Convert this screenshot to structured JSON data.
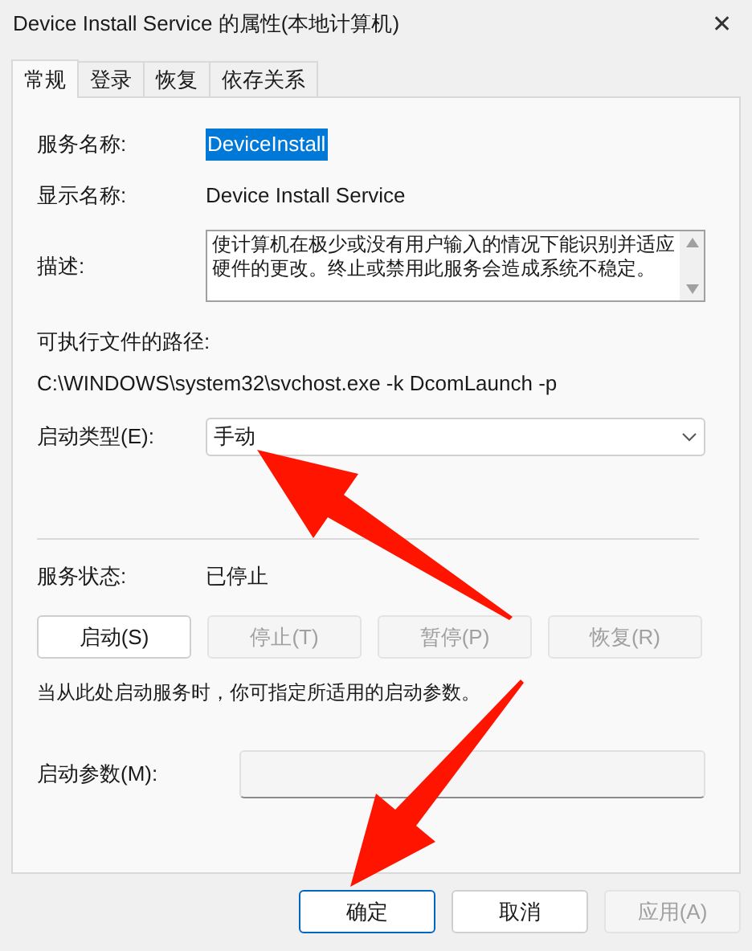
{
  "window": {
    "title": "Device Install Service 的属性(本地计算机)",
    "close": "✕"
  },
  "tabs": [
    {
      "label": "常规",
      "selected": true
    },
    {
      "label": "登录",
      "selected": false
    },
    {
      "label": "恢复",
      "selected": false
    },
    {
      "label": "依存关系",
      "selected": false
    }
  ],
  "service_name": {
    "label": "服务名称:",
    "value": "DeviceInstall",
    "selected": true
  },
  "display_name": {
    "label": "显示名称:",
    "value": "Device Install Service"
  },
  "description": {
    "label": "描述:",
    "value": "使计算机在极少或没有用户输入的情况下能识别并适应硬件的更改。终止或禁用此服务会造成系统不稳定。"
  },
  "executable_path": {
    "label": "可执行文件的路径:",
    "value": "C:\\WINDOWS\\system32\\svchost.exe -k DcomLaunch -p"
  },
  "startup_type": {
    "label": "启动类型(E):",
    "value": "手动"
  },
  "service_status": {
    "label": "服务状态:",
    "value": "已停止"
  },
  "service_buttons": [
    {
      "label": "启动(S)",
      "disabled": false
    },
    {
      "label": "停止(T)",
      "disabled": true
    },
    {
      "label": "暂停(P)",
      "disabled": true
    },
    {
      "label": "恢复(R)",
      "disabled": true
    }
  ],
  "hint": "当从此处启动服务时，你可指定所适用的启动参数。",
  "start_parameters": {
    "label": "启动参数(M):",
    "disabled": true
  },
  "dialog_buttons": [
    {
      "label": "确定",
      "default": true,
      "disabled": false
    },
    {
      "label": "取消",
      "default": false,
      "disabled": false
    },
    {
      "label": "应用(A)",
      "default": false,
      "disabled": true
    }
  ]
}
